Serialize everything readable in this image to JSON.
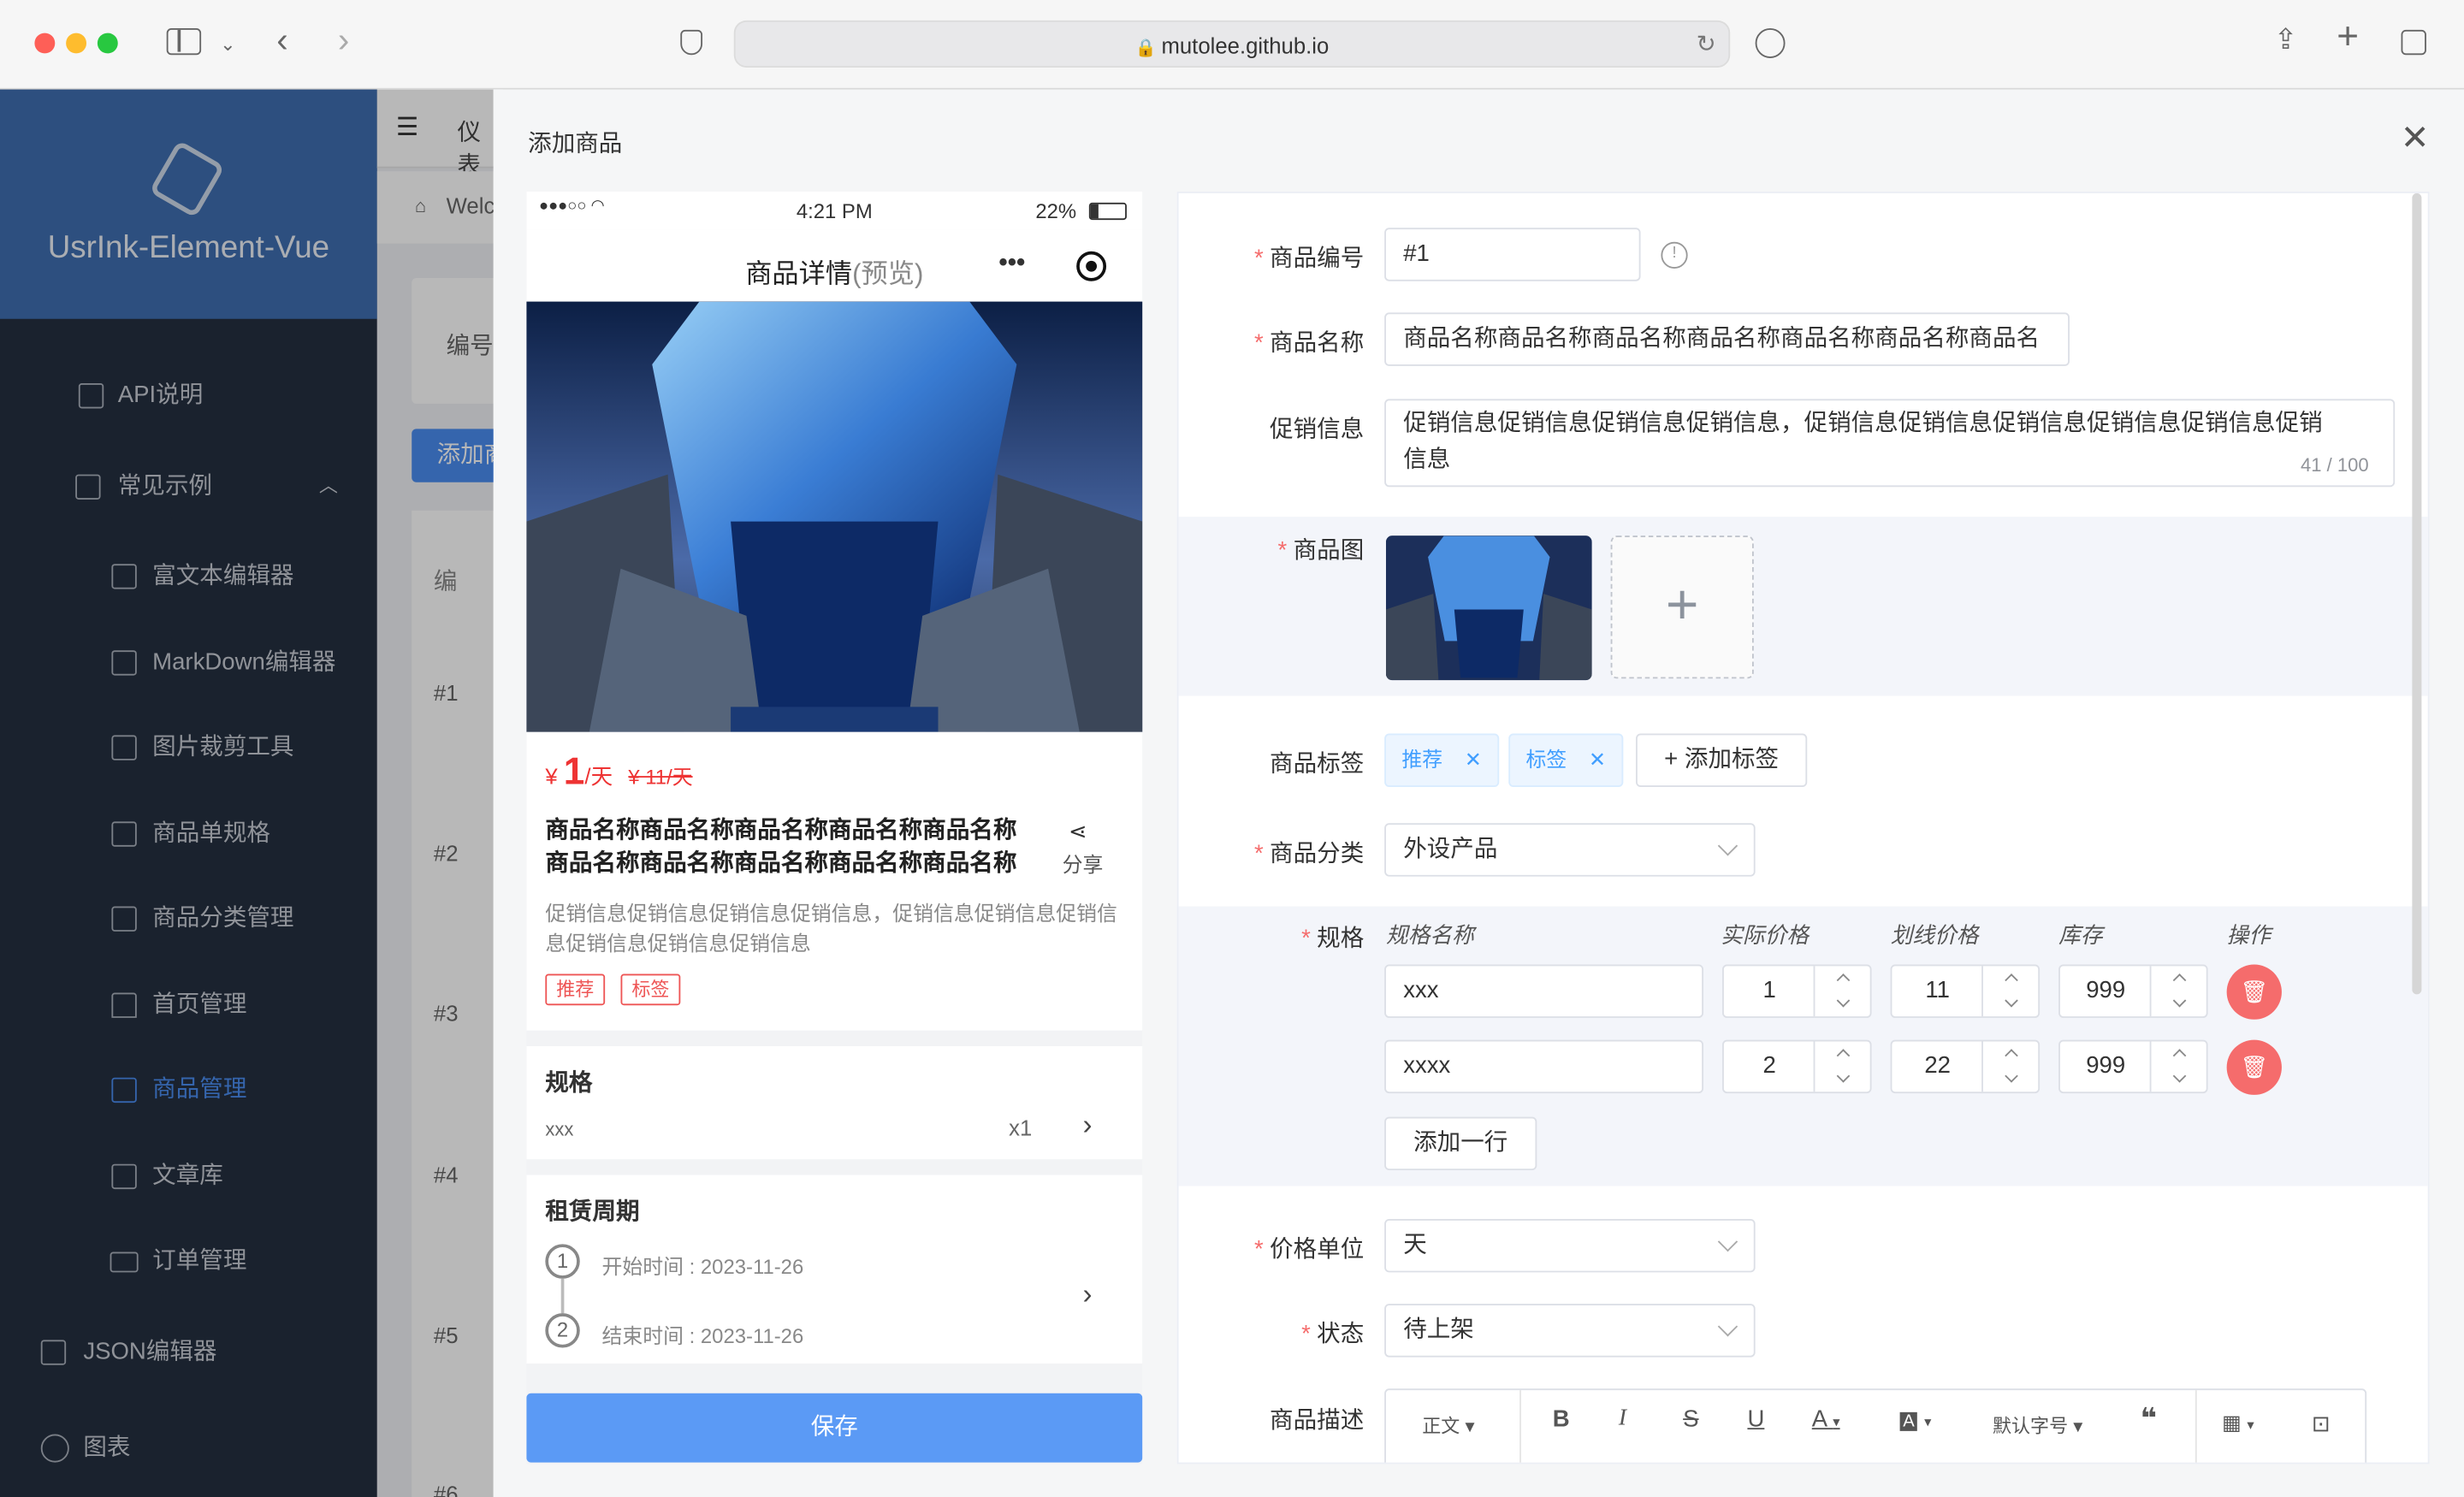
{
  "browser": {
    "url": "mutolee.github.io"
  },
  "sidebar": {
    "app_title": "UsrInk-Element-Vue",
    "items": [
      {
        "label": "API说明",
        "icon": "document-icon"
      },
      {
        "label": "常见示例",
        "icon": "folder-icon"
      },
      {
        "label": "富文本编辑器",
        "icon": "edit-icon"
      },
      {
        "label": "MarkDown编辑器",
        "icon": "edit-icon"
      },
      {
        "label": "图片裁剪工具",
        "icon": "picture-icon"
      },
      {
        "label": "商品单规格",
        "icon": "document-icon"
      },
      {
        "label": "商品分类管理",
        "icon": "list-icon"
      },
      {
        "label": "首页管理",
        "icon": "home-icon"
      },
      {
        "label": "商品管理",
        "icon": "bag-icon"
      },
      {
        "label": "文章库",
        "icon": "document-icon"
      },
      {
        "label": "订单管理",
        "icon": "truck-icon"
      },
      {
        "label": "JSON编辑器",
        "icon": "document-icon"
      },
      {
        "label": "图表",
        "icon": "pie-icon"
      }
    ]
  },
  "under": {
    "header": "仪表",
    "tab": "Welc",
    "col": "编号",
    "add": "添加商",
    "col2": "编",
    "rows": [
      "#1",
      "#2",
      "#3",
      "#4",
      "#5",
      "#6"
    ]
  },
  "drawer": {
    "title": "添加商品"
  },
  "phone": {
    "time": "4:21 PM",
    "battery": "22%",
    "nav_title": "商品详情",
    "nav_suffix": "(预览)",
    "currency": "¥",
    "price": "1",
    "price_unit": "/天",
    "orig_price": "¥ 11/天",
    "name": "商品名称商品名称商品名称商品名称商品名称商品名称商品名称商品名称商品名称商品名称",
    "share": "分享",
    "promo": "促销信息促销信息促销信息促销信息，促销信息促销信息促销信息促销信息促销信息促销信息",
    "tags": [
      "推荐",
      "标签"
    ],
    "spec_title": "规格",
    "spec_value": "xxx",
    "spec_qty": "x1",
    "rent_title": "租赁周期",
    "start_label": "开始时间 : 2023-11-26",
    "end_label": "结束时间 : 2023-11-26",
    "step1": "1",
    "step2": "2",
    "save": "保存"
  },
  "form": {
    "code_label": "商品编号",
    "code_value": "#1",
    "name_label": "商品名称",
    "name_value": "商品名称商品名称商品名称商品名称商品名称商品名称商品名",
    "promo_label": "促销信息",
    "promo_value": "促销信息促销信息促销信息促销信息，促销信息促销信息促销信息促销信息促销信息促销信息",
    "promo_count": "41 / 100",
    "image_label": "商品图",
    "tag_label": "商品标签",
    "tags": [
      "推荐",
      "标签"
    ],
    "add_tag": "+ 添加标签",
    "category_label": "商品分类",
    "category_value": "外设产品",
    "spec_label": "规格",
    "spec_headers": [
      "规格名称",
      "实际价格",
      "划线价格",
      "库存",
      "操作"
    ],
    "spec_rows": [
      {
        "name": "xxx",
        "price": "1",
        "orig": "11",
        "stock": "999"
      },
      {
        "name": "xxxx",
        "price": "2",
        "orig": "22",
        "stock": "999"
      }
    ],
    "add_row": "添加一行",
    "unit_label": "价格单位",
    "unit_value": "天",
    "status_label": "状态",
    "status_value": "待上架",
    "desc_label": "商品描述",
    "toolbar": {
      "para": "正文",
      "font_size": "默认字号"
    }
  }
}
